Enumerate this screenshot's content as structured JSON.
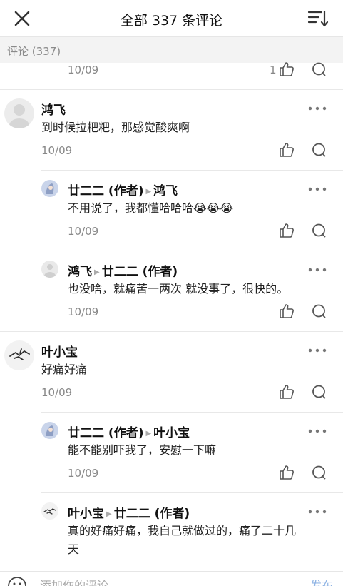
{
  "header": {
    "title": "全部 337 条评论"
  },
  "subheader": {
    "label": "评论 (337)"
  },
  "top_partial": {
    "date": "10/09",
    "like_count": "1"
  },
  "comments": [
    {
      "name": "鸿飞",
      "text": "到时候拉粑粑，那感觉酸爽啊",
      "date": "10/09"
    },
    {
      "author": "廿二二 (作者)",
      "target": "鸿飞",
      "text": "不用说了，我都懂哈哈哈😭😭😭",
      "date": "10/09"
    },
    {
      "author": "鸿飞",
      "target": "廿二二 (作者)",
      "text": "也没啥，就痛苦一两次 就没事了，很快的。",
      "date": "10/09"
    },
    {
      "name": "叶小宝",
      "text": "好痛好痛",
      "date": "10/09"
    },
    {
      "author": "廿二二 (作者)",
      "target": "叶小宝",
      "text": "能不能别吓我了，安慰一下嘛",
      "date": "10/09"
    },
    {
      "author": "叶小宝",
      "target": "廿二二 (作者)",
      "text_line1": "真的好痛好痛，我自己就做过的，痛了二十几",
      "text_line2": "天"
    }
  ],
  "footer": {
    "placeholder": "添加你的评论",
    "send_label": "发布"
  },
  "colors": {
    "accent": "#8fb4e4",
    "muted": "#888888",
    "divider": "#e8e8e8"
  }
}
